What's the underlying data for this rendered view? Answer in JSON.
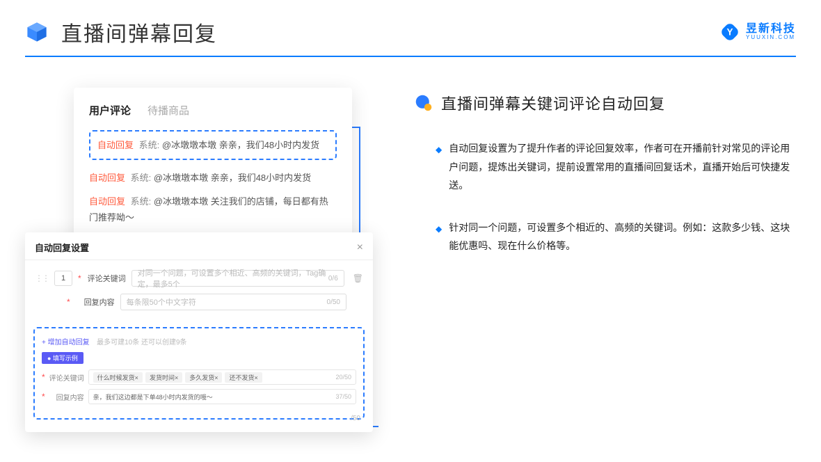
{
  "header": {
    "title": "直播间弹幕回复",
    "brand_cn": "昱新科技",
    "brand_en": "YUUXIN.COM"
  },
  "comments": {
    "tab_active": "用户评论",
    "tab_inactive": "待播商品",
    "auto_tag": "自动回复",
    "sys_label": "系统:",
    "row1": "@冰墩墩本墩 亲亲，我们48小时内发货",
    "row2": "@冰墩墩本墩 亲亲，我们48小时内发货",
    "row3": "@冰墩墩本墩 关注我们的店铺，每日都有热门推荐呦～"
  },
  "settings": {
    "title": "自动回复设置",
    "num": "1",
    "kw_label": "评论关键词",
    "kw_placeholder": "对同一个问题，可设置多个相近、高频的关键词，Tag确定，最多5个",
    "kw_count": "0/6",
    "content_label": "回复内容",
    "content_placeholder": "每条限50个中文字符",
    "content_count": "0/50",
    "add_text": "+ 增加自动回复",
    "add_hint": "最多可建10条 还可以创建9条",
    "badge": "● 填写示例",
    "ex_kw_label": "评论关键词",
    "chip1": "什么时候发货×",
    "chip2": "发货时间×",
    "chip3": "多久发货×",
    "chip4": "还不发货×",
    "ex_kw_count": "20/50",
    "ex_content_label": "回复内容",
    "ex_content_val": "亲，我们这边都是下单48小时内发货的哦～",
    "ex_content_count": "37/50",
    "bottom_count": "/50"
  },
  "right": {
    "section_title": "直播间弹幕关键词评论自动回复",
    "bullet1": "自动回复设置为了提升作者的评论回复效率，作者可在开播前针对常见的评论用户问题，提炼出关键词，提前设置常用的直播间回复话术，直播开始后可快捷发送。",
    "bullet2": "针对同一个问题，可设置多个相近的、高频的关键词。例如：这款多少钱、这块能优惠吗、现在什么价格等。"
  }
}
